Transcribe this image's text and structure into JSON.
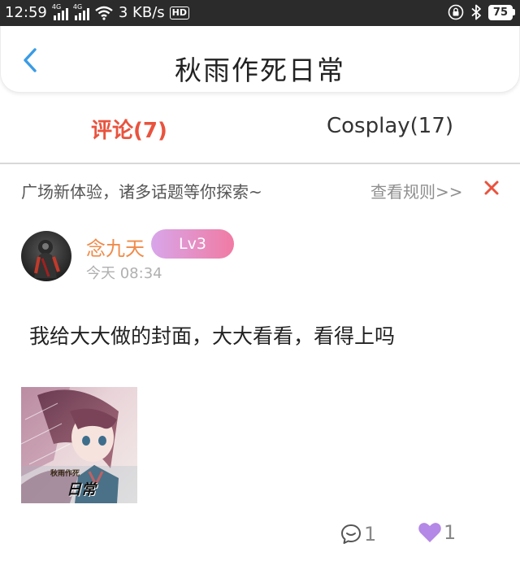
{
  "status_bar": {
    "time": "12:59",
    "net_tag_1": "4G",
    "net_tag_2": "4G",
    "speed": "3 KB/s",
    "hd_label": "HD",
    "battery": "75",
    "icons": [
      "signal-icon",
      "wifi-icon",
      "hd-icon",
      "lock-icon",
      "bluetooth-icon",
      "battery-icon"
    ]
  },
  "header": {
    "title": "秋雨作死日常",
    "back_icon": "chevron-left-icon"
  },
  "tabs": [
    {
      "label": "评论(7)",
      "active": true
    },
    {
      "label": "Cosplay(17)",
      "active": false
    }
  ],
  "notice": {
    "text": "广场新体验，诸多话题等你探索~",
    "link": "查看规则>>",
    "close_icon": "close-icon"
  },
  "post": {
    "username": "念九天",
    "level": "Lv3",
    "time": "今天 08:34",
    "content": "我给大大做的封面，大大看看，看得上吗",
    "image_caption_top": "秋雨作死",
    "image_caption": "日常",
    "comment_count": "1",
    "like_count": "1"
  },
  "colors": {
    "accent": "#e9533e",
    "username": "#f08b4a",
    "back_blue": "#3a9be6",
    "like_purple": "#b488e6"
  }
}
